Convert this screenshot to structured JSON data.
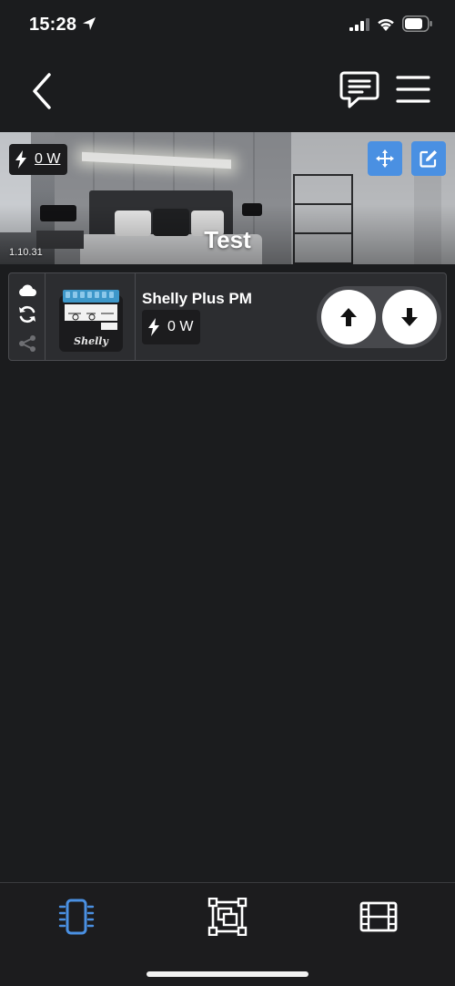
{
  "status_bar": {
    "time": "15:28",
    "icons": [
      "location-arrow-icon",
      "cellular-signal-icon",
      "wifi-icon",
      "battery-icon"
    ]
  },
  "header": {
    "icons": [
      "chevron-left-icon",
      "chat-icon",
      "hamburger-menu-icon"
    ]
  },
  "room": {
    "name": "Test",
    "power": "0 W",
    "image_code": "1.10.31",
    "actions": [
      "move-icon",
      "edit-icon"
    ]
  },
  "device": {
    "name": "Shelly Plus PM",
    "power": "0 W",
    "status_icons": [
      "cloud-icon",
      "sync-icon",
      "share-icon"
    ],
    "controls": [
      "arrow-up-icon",
      "arrow-down-icon"
    ]
  },
  "tabs": [
    {
      "name": "devices",
      "icon": "device-icon",
      "active": true
    },
    {
      "name": "rooms",
      "icon": "rooms-icon",
      "active": false
    },
    {
      "name": "scenes",
      "icon": "scenes-icon",
      "active": false
    }
  ],
  "colors": {
    "background": "#1b1c1e",
    "card": "#2c2d30",
    "accent": "#4a90e2",
    "text": "#ffffff",
    "muted": "#6e6f73"
  }
}
